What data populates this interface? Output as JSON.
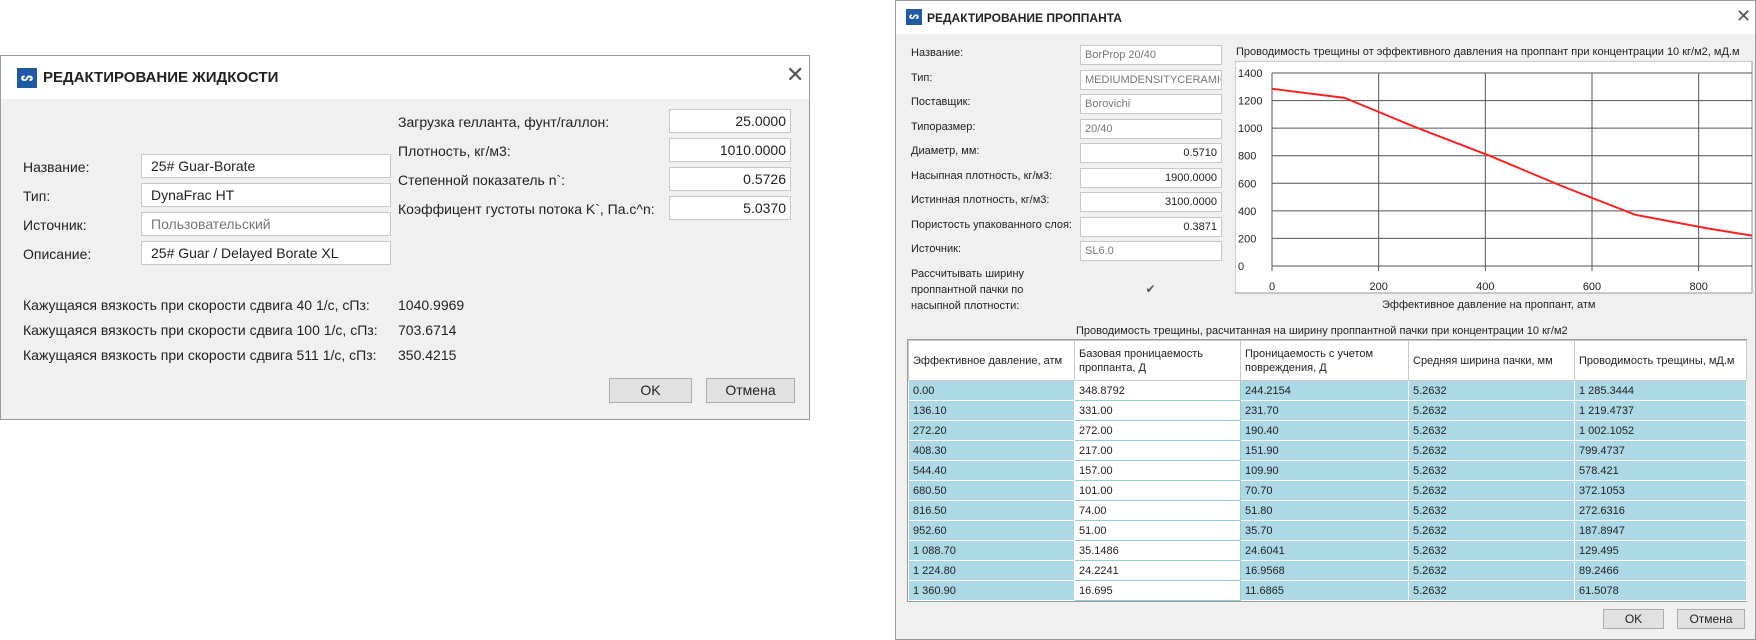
{
  "fluid_dialog": {
    "title": "РЕДАКТИРОВАНИЕ ЖИДКОСТИ",
    "icon": "app-logo-icon",
    "fields_left": [
      {
        "label": "Название:",
        "value": "25# Guar-Borate"
      },
      {
        "label": "Тип:",
        "value": "DynaFrac HT"
      },
      {
        "label": "Источник:",
        "value": "Пользовательский"
      },
      {
        "label": "Описание:",
        "value": "25# Guar / Delayed Borate XL"
      }
    ],
    "fields_right": [
      {
        "label": "Загрузка гелланта, фунт/галлон:",
        "value": "25.0000"
      },
      {
        "label": "Плотность, кг/м3:",
        "value": "1010.0000"
      },
      {
        "label": "Степенной показатель n`:",
        "value": "0.5726"
      },
      {
        "label": "Коэффицент густоты потока K`, Па.с^n:",
        "value": "5.0370"
      }
    ],
    "viscosity": [
      {
        "label": "Кажущаяся вязкость при скорости сдвига 40 1/с, сПз:",
        "value": "1040.9969"
      },
      {
        "label": "Кажущаяся вязкость при скорости сдвига 100 1/с, сПз:",
        "value": "703.6714"
      },
      {
        "label": "Кажущаяся вязкость при скорости сдвига 511 1/с, сПз:",
        "value": "350.4215"
      }
    ],
    "ok_label": "OK",
    "cancel_label": "Отмена"
  },
  "proppant_dialog": {
    "title": "РЕДАКТИРОВАНИЕ ПРОППАНТА",
    "icon": "app-logo-icon",
    "fields": [
      {
        "label": "Название:",
        "value": "BorProp 20/40"
      },
      {
        "label": "Тип:",
        "value": "MEDIUMDENSITYCERAMIC"
      },
      {
        "label": "Поставщик:",
        "value": "Borovichi"
      },
      {
        "label": "Типоразмер:",
        "value": "20/40"
      },
      {
        "label": "Диаметр, мм:",
        "value": "0.5710"
      },
      {
        "label": "Насыпная плотность, кг/м3:",
        "value": "1900.0000"
      },
      {
        "label": "Истинная плотность, кг/м3:",
        "value": "3100.0000"
      },
      {
        "label": "Пористость упакованного слоя:",
        "value": "0.3871"
      },
      {
        "label": "Источник:",
        "value": "SL6.0"
      }
    ],
    "checkbox_label_lines": [
      "Рассчитывать ширину",
      "проппантной пачки по",
      "насыпной плотности:"
    ],
    "checkbox_checked": true,
    "table_title": "Проводимость трещины, расчитанная на ширину проппантной пачки при концентрации 10 кг/м2",
    "table_headers": [
      [
        "Эффективное давление, атм"
      ],
      [
        "Базовая проницаемость",
        "проппанта, Д"
      ],
      [
        "Проницаемость с учетом",
        "повреждения, Д"
      ],
      [
        "Средняя ширина пачки, мм"
      ],
      [
        "Проводимость трещины, мД.м"
      ]
    ],
    "table_rows": [
      [
        "0.00",
        "348.8792",
        "244.2154",
        "5.2632",
        "1 285.3444"
      ],
      [
        "136.10",
        "331.00",
        "231.70",
        "5.2632",
        "1 219.4737"
      ],
      [
        "272.20",
        "272.00",
        "190.40",
        "5.2632",
        "1 002.1052"
      ],
      [
        "408.30",
        "217.00",
        "151.90",
        "5.2632",
        "799.4737"
      ],
      [
        "544.40",
        "157.00",
        "109.90",
        "5.2632",
        "578.421"
      ],
      [
        "680.50",
        "101.00",
        "70.70",
        "5.2632",
        "372.1053"
      ],
      [
        "816.50",
        "74.00",
        "51.80",
        "5.2632",
        "272.6316"
      ],
      [
        "952.60",
        "51.00",
        "35.70",
        "5.2632",
        "187.8947"
      ],
      [
        "1 088.70",
        "35.1486",
        "24.6041",
        "5.2632",
        "129.495"
      ],
      [
        "1 224.80",
        "24.2241",
        "16.9568",
        "5.2632",
        "89.2466"
      ],
      [
        "1 360.90",
        "16.695",
        "11.6865",
        "5.2632",
        "61.5078"
      ]
    ],
    "ok_label": "OK",
    "cancel_label": "Отмена"
  },
  "chart_data": {
    "type": "line",
    "title": "Проводимость трещины от эффективного давления на проппант при концентрации 10 кг/м2, мД.м",
    "xlabel": "Эффективное давление на проппант, атм",
    "ylabel": "",
    "xlim": [
      0,
      900
    ],
    "ylim": [
      0,
      1400
    ],
    "x_ticks": [
      "0",
      "200",
      "400",
      "600",
      "800"
    ],
    "y_ticks": [
      "1400",
      "1200",
      "1000",
      "800",
      "600",
      "400",
      "200",
      "0"
    ],
    "grid": true,
    "series": [
      {
        "x": [
          0,
          136.1,
          272.2,
          408.3,
          544.4,
          680.5,
          816.5,
          952.6
        ],
        "y": [
          1285.3444,
          1219.4737,
          1002.1052,
          799.4737,
          578.421,
          372.1053,
          272.6316,
          187.8947
        ],
        "color": "#ff2020"
      }
    ]
  }
}
